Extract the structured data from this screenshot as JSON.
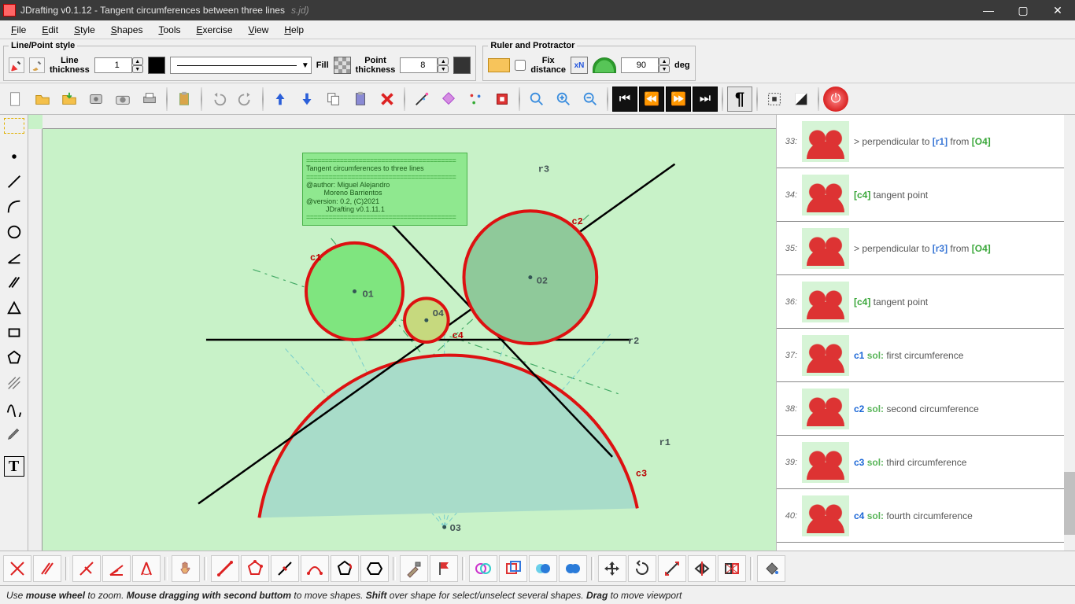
{
  "window": {
    "title": "JDrafting   v0.1.12 - Tangent circumferences between three lines",
    "title_tail": "s.jd)"
  },
  "menu": [
    "File",
    "Edit",
    "Style",
    "Shapes",
    "Tools",
    "Exercise",
    "View",
    "Help"
  ],
  "lineStyle": {
    "legend": "Line/Point style",
    "thicknessLabel": "Line\nthickness",
    "thicknessValue": 1,
    "fillLabel": "Fill",
    "pointThicknessLabel": "Point\nthickness",
    "pointThicknessValue": 8
  },
  "ruler": {
    "legend": "Ruler and Protractor",
    "fixLabel": "Fix\ndistance",
    "xn": "xN",
    "angleValue": 90,
    "deg": "deg"
  },
  "note": {
    "title": "Tangent circumferences to three lines",
    "author": "@author: Miguel Alejandro",
    "author2": "         Moreno Barrientos",
    "version": "@version: 0.2, (C)2021",
    "tool": "          JDrafting v0.1.11.1"
  },
  "canvasLabels": {
    "r1": "r1",
    "r2": "r2",
    "r3": "r3",
    "c1": "c1",
    "c2": "c2",
    "c3": "c3",
    "c4": "c4",
    "o1": "O1",
    "o2": "O2",
    "o3": "O3",
    "o4": "O4"
  },
  "steps": [
    {
      "n": "33",
      "html": "> perpendicular to <span class='k-b'>[r1]</span> from <span class='k-br'>[O4]</span>"
    },
    {
      "n": "34",
      "html": "<span class='k-br'>[c4]</span> tangent point"
    },
    {
      "n": "35",
      "html": "> perpendicular to <span class='k-b'>[r3]</span> from <span class='k-br'>[O4]</span>"
    },
    {
      "n": "36",
      "html": "<span class='k-br'>[c4]</span> tangent point"
    },
    {
      "n": "37",
      "html": "<span class='k-c'>c1</span> <span class='k-sol'>sol:</span> first circumference"
    },
    {
      "n": "38",
      "html": "<span class='k-c'>c2</span> <span class='k-sol'>sol:</span> second circumference"
    },
    {
      "n": "39",
      "html": "<span class='k-c'>c3</span> <span class='k-sol'>sol:</span> third circumference"
    },
    {
      "n": "40",
      "html": "<span class='k-c'>c4</span> <span class='k-sol'>sol:</span> fourth circumference"
    }
  ],
  "status": "Use <b>mouse wheel</b> to zoom. <b>Mouse dragging with second buttom</b> to move shapes. <b>Shift</b> over shape for select/unselect several shapes. <b>Drag</b> to move viewport"
}
